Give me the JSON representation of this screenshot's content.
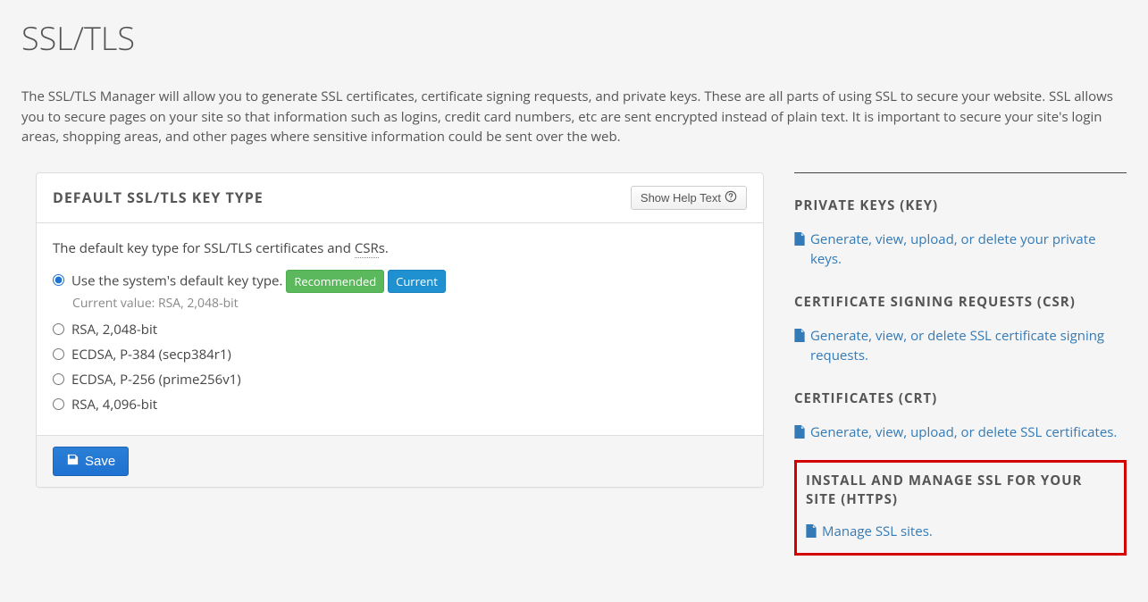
{
  "page": {
    "title": "SSL/TLS",
    "intro": "The SSL/TLS Manager will allow you to generate SSL certificates, certificate signing requests, and private keys. These are all parts of using SSL to secure your website. SSL allows you to secure pages on your site so that information such as logins, credit card numbers, etc are sent encrypted instead of plain text. It is important to secure your site's login areas, shopping areas, and other pages where sensitive information could be sent over the web."
  },
  "panel": {
    "title": "DEFAULT SSL/TLS KEY TYPE",
    "help_label": "Show Help Text",
    "description_prefix": "The default key type for SSL/TLS certificates and ",
    "description_csr": "CSR",
    "description_suffix": "s.",
    "options": {
      "system_default": "Use the system's default key type.",
      "badge_recommended": "Recommended",
      "badge_current": "Current",
      "current_value_label": "Current value: RSA, 2,048-bit",
      "rsa2048": "RSA, 2,048-bit",
      "ecdsa_p384": "ECDSA, P-384 (secp384r1)",
      "ecdsa_p256": "ECDSA, P-256 (prime256v1)",
      "rsa4096": "RSA, 4,096-bit"
    },
    "save_label": "Save"
  },
  "sidebar": {
    "private_keys": {
      "heading": "PRIVATE KEYS (KEY)",
      "link": "Generate, view, upload, or delete your private keys."
    },
    "csr": {
      "heading": "CERTIFICATE SIGNING REQUESTS (CSR)",
      "link": "Generate, view, or delete SSL certificate signing requests."
    },
    "certs": {
      "heading": "CERTIFICATES (CRT)",
      "link": "Generate, view, upload, or delete SSL certificates."
    },
    "install": {
      "heading": "INSTALL AND MANAGE SSL FOR YOUR SITE (HTTPS)",
      "link": "Manage SSL sites."
    }
  }
}
